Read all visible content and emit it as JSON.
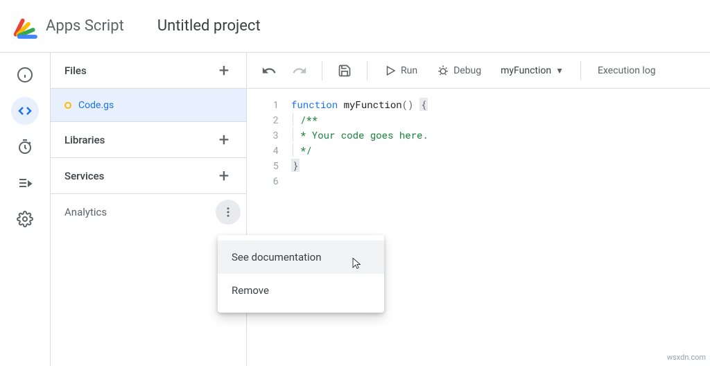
{
  "header": {
    "app_name": "Apps Script",
    "project_title": "Untitled project"
  },
  "sidebar": {
    "files_label": "Files",
    "file_name": "Code.gs",
    "libraries_label": "Libraries",
    "services_label": "Services",
    "analytics_label": "Analytics"
  },
  "toolbar": {
    "run_label": "Run",
    "debug_label": "Debug",
    "func_name": "myFunction",
    "exec_log_label": "Execution log"
  },
  "code": {
    "gutter": [
      "1",
      "2",
      "3",
      "4",
      "5",
      "6"
    ],
    "kw": "function",
    "fn": "myFunction",
    "open": "()",
    "brace_open": "{",
    "c1": "/**",
    "c2": "* Your code goes here.",
    "c3": "*/",
    "brace_close": "}"
  },
  "menu": {
    "see_doc": "See documentation",
    "remove": "Remove"
  },
  "watermark": "wsxdn.com"
}
